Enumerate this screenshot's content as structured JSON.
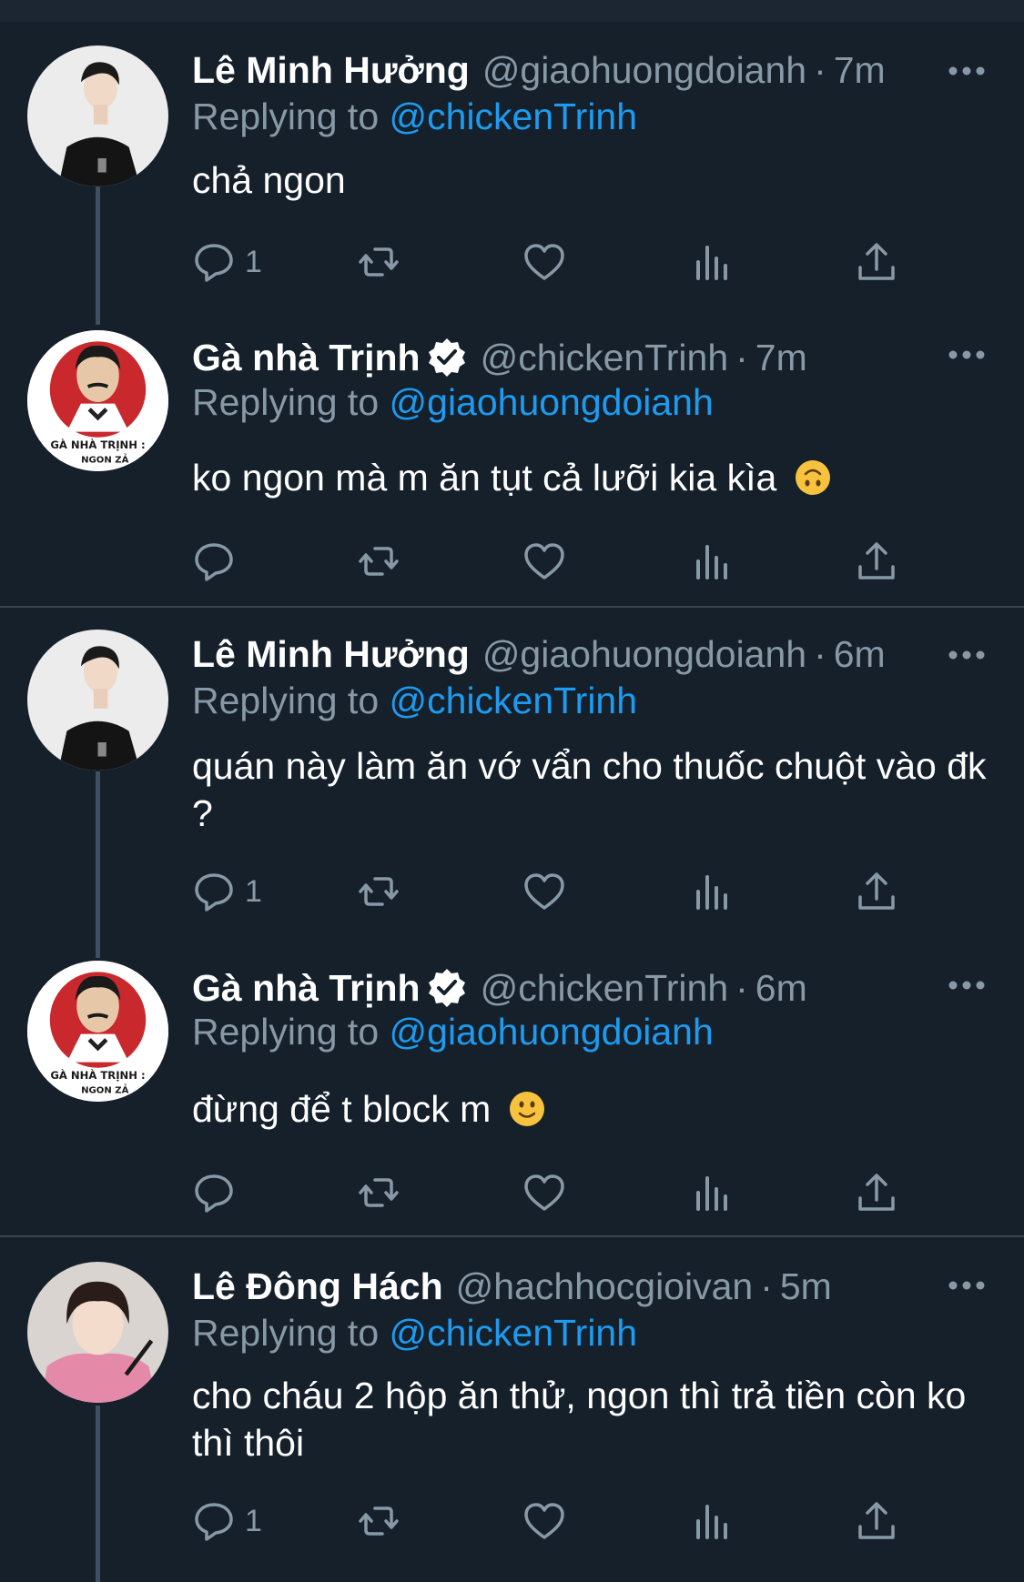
{
  "tweets": [
    {
      "name": "Lê Minh Hưởng",
      "handle": "@giaohuongdoianh",
      "time": "7m",
      "replying_prefix": "Replying to ",
      "replying_to": "@chickenTrinh",
      "text": "chả ngon",
      "reply_count": "1",
      "verified": false,
      "avatar": "male-portrait-black-hoodie"
    },
    {
      "name": "Gà nhà Trịnh",
      "handle": "@chickenTrinh",
      "time": "7m",
      "replying_prefix": "Replying to ",
      "replying_to": "@giaohuongdoianh",
      "text": "ko ngon mà m ăn tụt cả lưỡi kia kìa",
      "emoji": "upside-down-face",
      "reply_count": "",
      "verified": true,
      "avatar": "chicken-shop-logo",
      "avatar_text": "GÀ NHÀ TRỊNH :"
    },
    {
      "name": "Lê Minh Hưởng",
      "handle": "@giaohuongdoianh",
      "time": "6m",
      "replying_prefix": "Replying to ",
      "replying_to": "@chickenTrinh",
      "text": "quán này làm ăn vớ vẩn cho thuốc chuột vào đk ?",
      "reply_count": "1",
      "verified": false,
      "avatar": "male-portrait-black-hoodie"
    },
    {
      "name": "Gà nhà Trịnh",
      "handle": "@chickenTrinh",
      "time": "6m",
      "replying_prefix": "Replying to ",
      "replying_to": "@giaohuongdoianh",
      "text": "đừng để t block m",
      "emoji": "slightly-smiling-face",
      "reply_count": "",
      "verified": true,
      "avatar": "chicken-shop-logo",
      "avatar_text": "GÀ NHÀ TRỊNH :"
    },
    {
      "name": "Lê Đông Hách",
      "handle": "@hachhocgioivan",
      "time": "5m",
      "replying_prefix": "Replying to ",
      "replying_to": "@chickenTrinh",
      "text": "cho cháu 2 hộp ăn thử, ngon thì trả tiền còn ko thì thôi",
      "reply_count": "1",
      "verified": false,
      "avatar": "male-portrait-pink-hoodie"
    }
  ],
  "separator": "·",
  "icons": [
    "reply-icon",
    "retweet-icon",
    "like-icon",
    "analytics-icon",
    "share-icon",
    "more-icon",
    "verified-badge-icon"
  ],
  "colors": {
    "background": "#15202b",
    "secondary_text": "#8899a6",
    "link": "#1d9bf0",
    "divider": "#38444d"
  }
}
